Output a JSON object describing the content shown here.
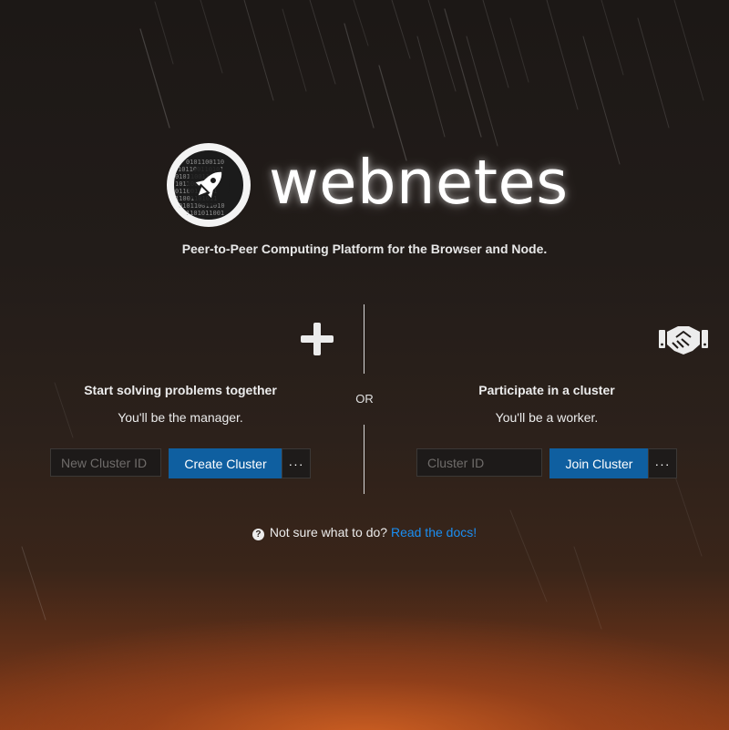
{
  "brand": {
    "name": "webnetes",
    "tagline": "Peer-to-Peer Computing Platform for the Browser and Node.",
    "logo_icon": "rocket-icon"
  },
  "manager": {
    "icon": "plus-icon",
    "title": "Start solving problems together",
    "subtitle": "You'll be the manager.",
    "input_placeholder": "New Cluster ID",
    "button_label": "Create Cluster",
    "more_label": "···"
  },
  "divider": {
    "label": "OR"
  },
  "worker": {
    "icon": "handshake-icon",
    "title": "Participate in a cluster",
    "subtitle": "You'll be a worker.",
    "input_placeholder": "Cluster ID",
    "button_label": "Join Cluster",
    "more_label": "···"
  },
  "help": {
    "icon": "question-circle-icon",
    "text": "Not sure what to do?",
    "link_label": "Read the docs!"
  },
  "colors": {
    "primary": "#0f5fa0",
    "link": "#1b8ef2",
    "glow": "#d6642a"
  }
}
